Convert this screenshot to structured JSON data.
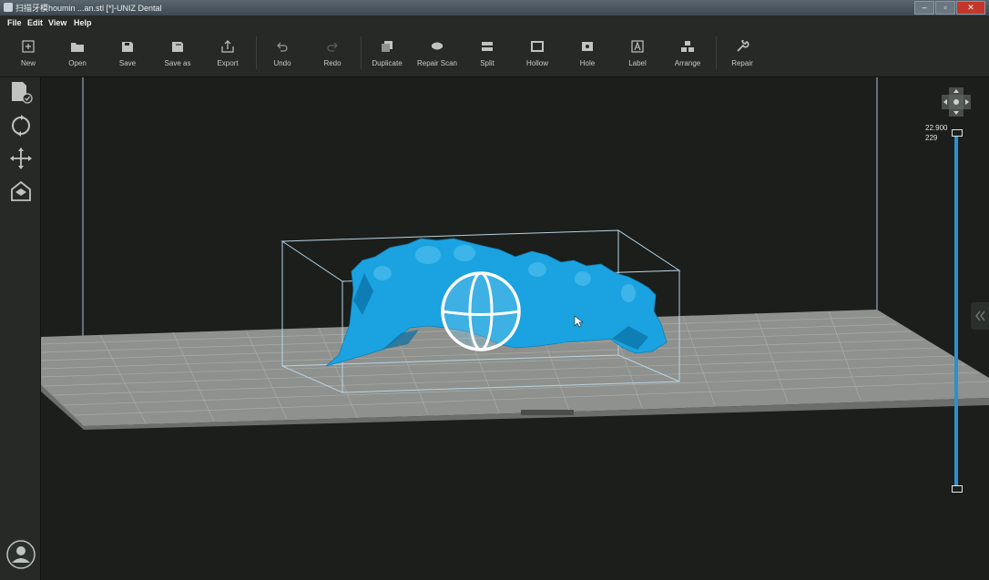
{
  "window": {
    "title": "扫描牙模houmin ...an.stl [*]-UNIZ Dental",
    "minimize": "–",
    "restore": "▫",
    "close": "✕"
  },
  "menu": [
    "File",
    "Edit",
    "View",
    "Help"
  ],
  "toolbar": {
    "new": "New",
    "open": "Open",
    "save": "Save",
    "save_as": "Save as",
    "export": "Export",
    "undo": "Undo",
    "redo": "Redo",
    "duplicate": "Duplicate",
    "repair_scan": "Repair Scan",
    "split": "Split",
    "hollow": "Hollow",
    "hole": "Hole",
    "label": "Label",
    "arrange": "Arrange",
    "repair": "Repair"
  },
  "sidebar_icons": [
    "document-check-icon",
    "rotate-icon",
    "move-icon",
    "home-view-icon",
    "user-avatar-icon"
  ],
  "layer_slider": {
    "height_value": "22.900",
    "layer_value": "229"
  },
  "colors": {
    "model": "#1aa3e0",
    "bed": "#8e918d",
    "slider": "#2d8fd0"
  }
}
